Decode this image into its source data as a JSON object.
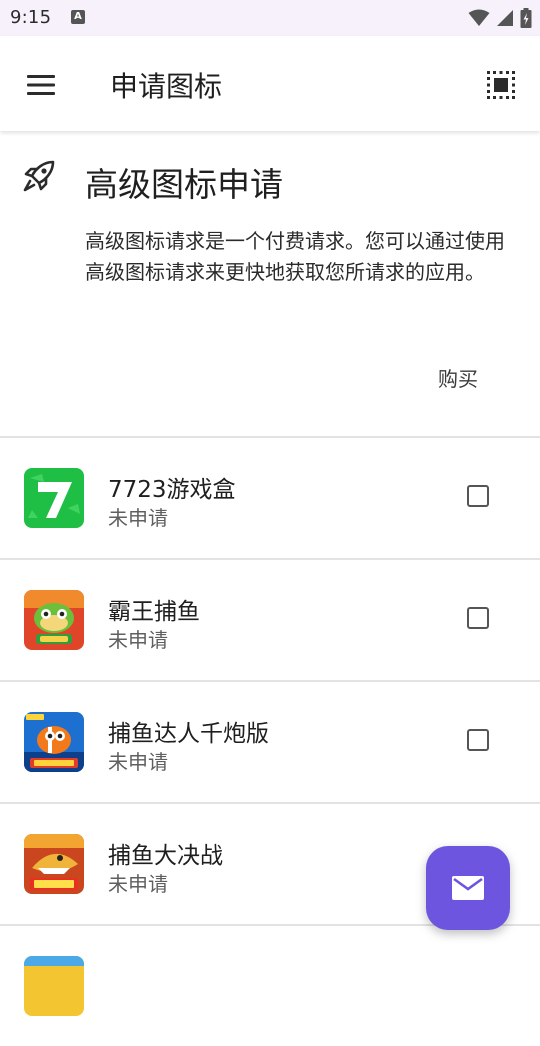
{
  "status_bar": {
    "time": "9:15",
    "notification_letter": "A"
  },
  "app_bar": {
    "title": "申请图标",
    "menu_icon": "hamburger-menu-icon",
    "select_icon": "select-all-icon"
  },
  "premium": {
    "title": "高级图标申请",
    "description": "高级图标请求是一个付费请求。您可以通过使用高级图标请求来更快地获取您所请求的应用。",
    "buy_label": "购买"
  },
  "apps": [
    {
      "name": "7723游戏盒",
      "status": "未申请",
      "checked": false,
      "icon": "7723-logo"
    },
    {
      "name": "霸王捕鱼",
      "status": "未申请",
      "checked": false,
      "icon": "fish-game-icon"
    },
    {
      "name": "捕鱼达人千炮版",
      "status": "未申请",
      "checked": false,
      "icon": "clownfish-game-icon"
    },
    {
      "name": "捕鱼大决战",
      "status": "未申请",
      "checked": false,
      "icon": "shark-game-icon"
    }
  ],
  "fab": {
    "icon": "mail-icon"
  },
  "colors": {
    "status_bar_bg": "#f6f1fb",
    "fab": "#6d55e0",
    "green_icon": "#1fbf45"
  }
}
